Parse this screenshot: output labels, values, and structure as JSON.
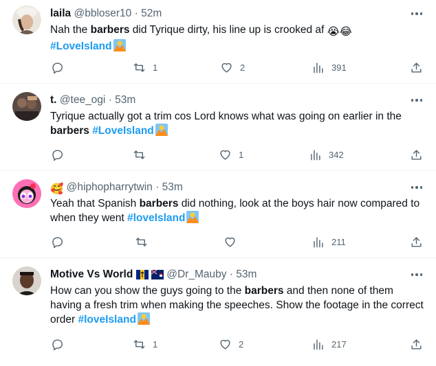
{
  "colors": {
    "link": "#1d9bf0",
    "secondary": "#536471",
    "text": "#0f1419",
    "divider": "#eff3f4"
  },
  "tweets": [
    {
      "name": "laila",
      "handle": "@bbloser10",
      "dot": "·",
      "time": "52m",
      "text_before": "Nah the ",
      "text_bold": "barbers",
      "text_after": " did Tyrique dirty, his line up is crooked af",
      "emojis": "😭😂",
      "hashtag": "#LoveIsland",
      "hashtag_icon": "sun-volcano-icon",
      "reply_count": "",
      "retweet_count": "1",
      "like_count": "2",
      "views": "391"
    },
    {
      "name": "t.",
      "handle": "@tee_ogi",
      "dot": "·",
      "time": "53m",
      "text_before": "Tyrique actually got a trim cos Lord knows what was going on earlier in the",
      "text_bold": "barbers",
      "text_after": " ",
      "hashtag": "#LoveIsland",
      "hashtag_icon": "sun-volcano-icon",
      "reply_count": "",
      "retweet_count": "",
      "like_count": "1",
      "views": "342"
    },
    {
      "name_emoji": "🥰",
      "handle": "@hiphopharrytwin",
      "dot": "·",
      "time": "53m",
      "text_before": "Yeah that Spanish ",
      "text_bold": "barbers",
      "text_after": " did nothing, look at the boys hair now compared to when they went ",
      "hashtag": "#loveIsland",
      "hashtag_icon": "sun-volcano-icon",
      "reply_count": "",
      "retweet_count": "",
      "like_count": "",
      "views": "211"
    },
    {
      "name": "Motive Vs World",
      "flags": [
        "barbados-flag-icon",
        "cayman-flag-icon"
      ],
      "handle": "@Dr_Mauby",
      "dot": "·",
      "time": "53m",
      "text_before": "How can you show the guys going to the ",
      "text_bold": "barbers",
      "text_after": " and then none of them having a fresh trim when making the speeches. Show the footage in the correct order ",
      "hashtag": "#loveIsland",
      "hashtag_icon": "sun-volcano-icon",
      "reply_count": "",
      "retweet_count": "1",
      "like_count": "2",
      "views": "217"
    }
  ]
}
